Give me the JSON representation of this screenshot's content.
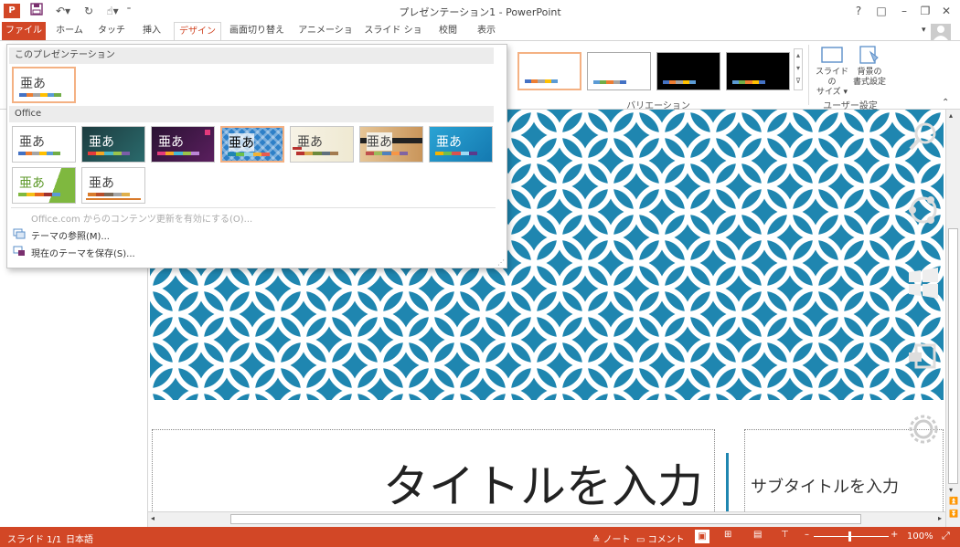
{
  "window": {
    "title": "プレゼンテーション1 - PowerPoint",
    "controls": [
      "?",
      "□",
      "–",
      "❐",
      "✕"
    ]
  },
  "tabs": [
    "ファイル",
    "ホーム",
    "タッチ",
    "挿入",
    "デザイン",
    "画面切り替え",
    "アニメーション",
    "スライド ショー",
    "校閲",
    "表示"
  ],
  "ribbon": {
    "variations_label": "バリエーション",
    "user_settings_label": "ユーザー設定",
    "slide_size_label": "スライドの\nサイズ ▾",
    "slide_size_l1": "スライドの",
    "slide_size_l2": "サイズ ▾",
    "bg_format_l1": "背景の",
    "bg_format_l2": "書式設定"
  },
  "dropdown": {
    "section_this": "このプレゼンテーション",
    "section_office": "Office",
    "theme_sample_text": "亜あ",
    "office_update": "Office.com からのコンテンツ更新を有効にする(O)...",
    "browse_themes": "テーマの参照(M)...",
    "save_theme": "現在のテーマを保存(S)..."
  },
  "slide": {
    "title_placeholder": "タイトルを入力",
    "subtitle_placeholder": "サブタイトルを入力",
    "pattern_color": "#1f86b0"
  },
  "statusbar": {
    "slide_info": "スライド 1/1",
    "language": "日本語",
    "notes": "ノート",
    "comments": "コメント",
    "zoom": "100%"
  },
  "colors": {
    "accent": "#d24726",
    "slide_blue": "#1f86b0"
  }
}
